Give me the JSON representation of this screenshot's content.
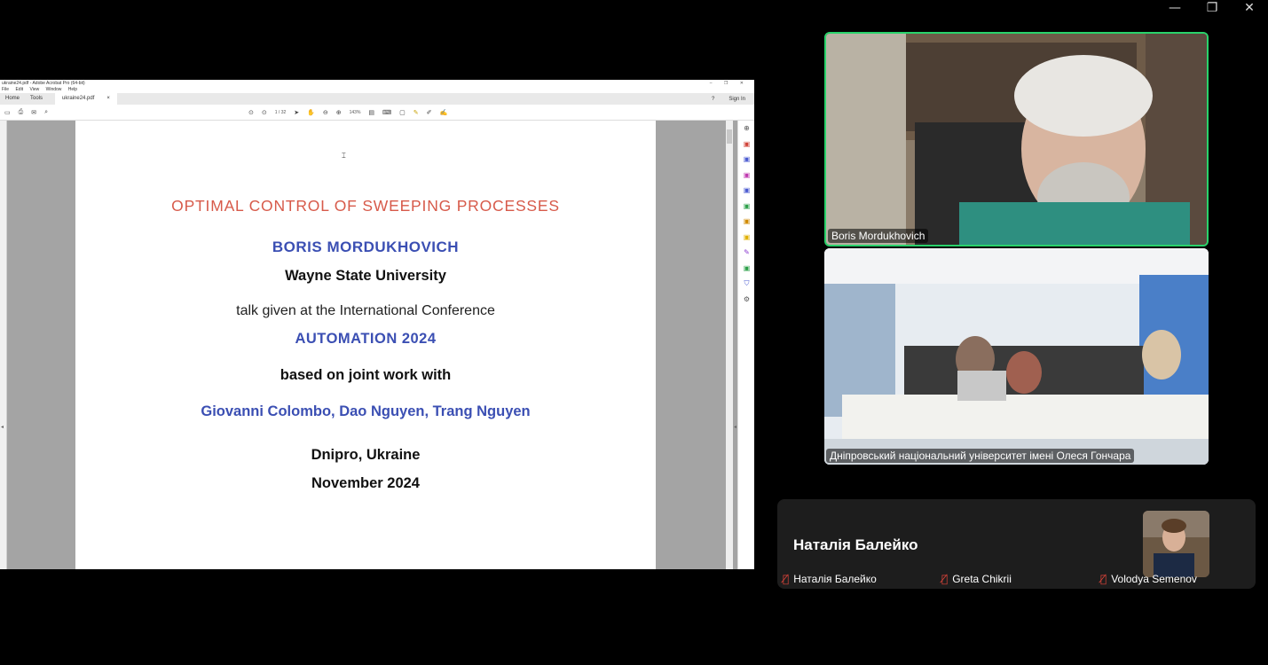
{
  "window_controls": {
    "minimize": "—",
    "restore": "❐",
    "close": "✕"
  },
  "acrobat": {
    "title_bar": "ukraine24.pdf - Adobe Acrobat Pro (64-bit)",
    "menu": [
      "File",
      "Edit",
      "View",
      "Window",
      "Help"
    ],
    "tabs": {
      "home": "Home",
      "tools": "Tools",
      "doc": "ukraine24.pdf",
      "doc_close": "×"
    },
    "help_icon": "?",
    "sign_in": "Sign In",
    "page_indicator": "1  / 32",
    "zoom": "143%"
  },
  "slide": {
    "title": "OPTIMAL CONTROL OF SWEEPING PROCESSES",
    "author": "BORIS MORDUKHOVICH",
    "university": "Wayne State University",
    "talk_line": "talk given at the International Conference",
    "conference": "AUTOMATION 2024",
    "based_on": "based on joint work with",
    "coauthors": "Giovanni Colombo, Dao Nguyen, Trang Nguyen",
    "place": "Dnipro, Ukraine",
    "date": "November 2024"
  },
  "participants": {
    "speaker_tile": "Boris Mordukhovich",
    "room_tile": "Дніпровський національний університет імені Олеся Гончара",
    "panel_active_name": "Наталія Балейко",
    "list": [
      {
        "name": "Наталія Балейко",
        "muted": true
      },
      {
        "name": "Greta Chikrii",
        "muted": true
      },
      {
        "name": "Volodya Semenov",
        "muted": true
      }
    ]
  },
  "colors": {
    "active_speaker_border": "#29d36b",
    "slide_title": "#d75a4a",
    "slide_blue": "#3b4fb3",
    "muted_mic": "#e0443a"
  }
}
